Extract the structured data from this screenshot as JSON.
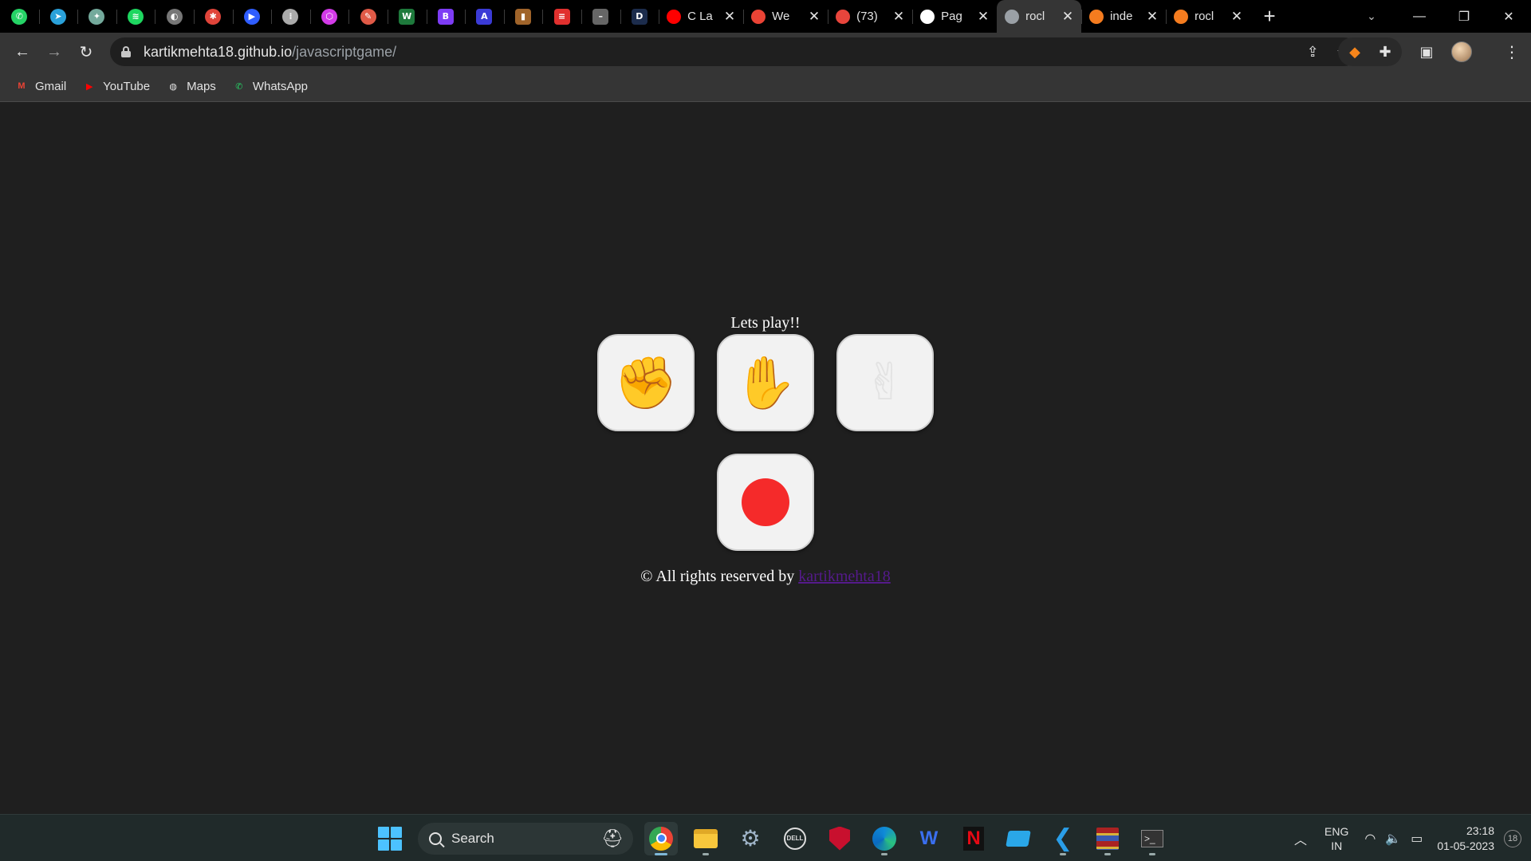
{
  "browser": {
    "pinned_tabs": [
      {
        "icon": "whatsapp-icon",
        "color": "#25d366",
        "glyph": "✆"
      },
      {
        "icon": "telegram-icon",
        "color": "#2aa1da",
        "glyph": "➤"
      },
      {
        "icon": "chatgpt-icon",
        "color": "#74aa9c",
        "glyph": "✦"
      },
      {
        "icon": "spotify-icon",
        "color": "#1ed760",
        "glyph": "≋"
      },
      {
        "icon": "gray-circle-icon",
        "color": "#777777",
        "glyph": "◐"
      },
      {
        "icon": "asterisk-icon",
        "color": "#e0443a",
        "glyph": "✱"
      },
      {
        "icon": "blue-tag-icon",
        "color": "#2f5dff",
        "glyph": "▶"
      },
      {
        "icon": "dots-grid-icon",
        "color": "#aaaaaa",
        "glyph": "⁞"
      },
      {
        "icon": "hexagon-icon",
        "color": "#d33be8",
        "glyph": "⬡"
      },
      {
        "icon": "pencil-icon",
        "color": "#e05a47",
        "glyph": "✎"
      },
      {
        "icon": "w-icon",
        "color": "#1e7a3c",
        "glyph": "W"
      },
      {
        "icon": "bootstrap-icon",
        "color": "#7d3cf5",
        "glyph": "B"
      },
      {
        "icon": "a-icon",
        "color": "#3b3bd6",
        "glyph": "A"
      },
      {
        "icon": "book-icon",
        "color": "#a0642a",
        "glyph": "▮"
      },
      {
        "icon": "red-bars-icon",
        "color": "#e1302e",
        "glyph": "≡"
      },
      {
        "icon": "dash-icon",
        "color": "#666666",
        "glyph": "–"
      },
      {
        "icon": "d-icon",
        "color": "#1c2c4c",
        "glyph": "D"
      }
    ],
    "tabs": [
      {
        "title": "C La",
        "icon": "youtube-icon",
        "color": "#ff0000",
        "active": false
      },
      {
        "title": "We",
        "icon": "gmail-icon",
        "color": "#ea4335",
        "active": false
      },
      {
        "title": "(73)",
        "icon": "reddit-badge-icon",
        "color": "#e8453c",
        "active": false
      },
      {
        "title": "Pag",
        "icon": "github-icon",
        "color": "#ffffff",
        "active": false
      },
      {
        "title": "rocl",
        "icon": "globe-icon",
        "color": "#9aa0a6",
        "active": true
      },
      {
        "title": "inde",
        "icon": "orange-squares-icon",
        "color": "#f57c1f",
        "active": false
      },
      {
        "title": "rocl",
        "icon": "orange-squares-icon",
        "color": "#f57c1f",
        "active": false
      }
    ],
    "url_host": "kartikmehta18.github.io",
    "url_path": "/javascriptgame/",
    "bookmarks": [
      {
        "label": "Gmail",
        "icon": "gmail-icon"
      },
      {
        "label": "YouTube",
        "icon": "youtube-icon"
      },
      {
        "label": "Maps",
        "icon": "globe-icon"
      },
      {
        "label": "WhatsApp",
        "icon": "whatsapp-icon"
      }
    ]
  },
  "game": {
    "title": "Lets play!!",
    "choices": [
      {
        "name": "rock",
        "glyph": "✊"
      },
      {
        "name": "paper",
        "glyph": "✋"
      },
      {
        "name": "scissors",
        "glyph": "✌"
      }
    ],
    "result_color": "#f52a2a",
    "footer_text": "© All rights reserved by ",
    "footer_link": "kartikmehta18"
  },
  "taskbar": {
    "search_label": "Search",
    "lang_line1": "ENG",
    "lang_line2": "IN",
    "time": "23:18",
    "date": "01-05-2023",
    "notification_count": "18"
  }
}
